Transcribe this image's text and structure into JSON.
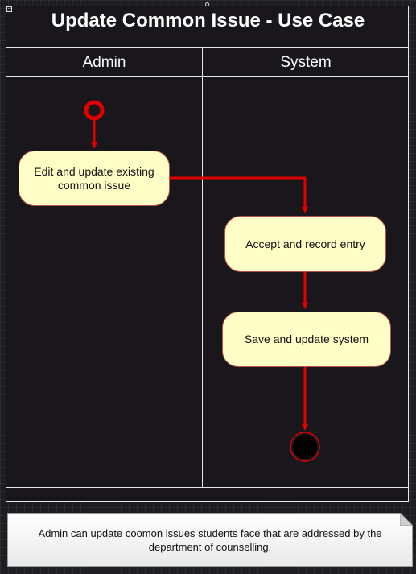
{
  "diagram": {
    "title": "Update Common Issue - Use Case",
    "lanes": [
      "Admin",
      "System"
    ],
    "nodes": {
      "edit": "Edit and update existing common issue",
      "accept": "Accept and record entry",
      "save": "Save and update system"
    },
    "note": "Admin can update coomon issues students face that are addressed by the department of counselling."
  },
  "colors": {
    "arrow": "#e00000",
    "node_fill": "#fefec6",
    "node_border": "#b85450",
    "background": "#1e1d22"
  },
  "icons": [
    "collapse-icon",
    "handle-icon",
    "start-node-icon",
    "end-node-icon"
  ]
}
